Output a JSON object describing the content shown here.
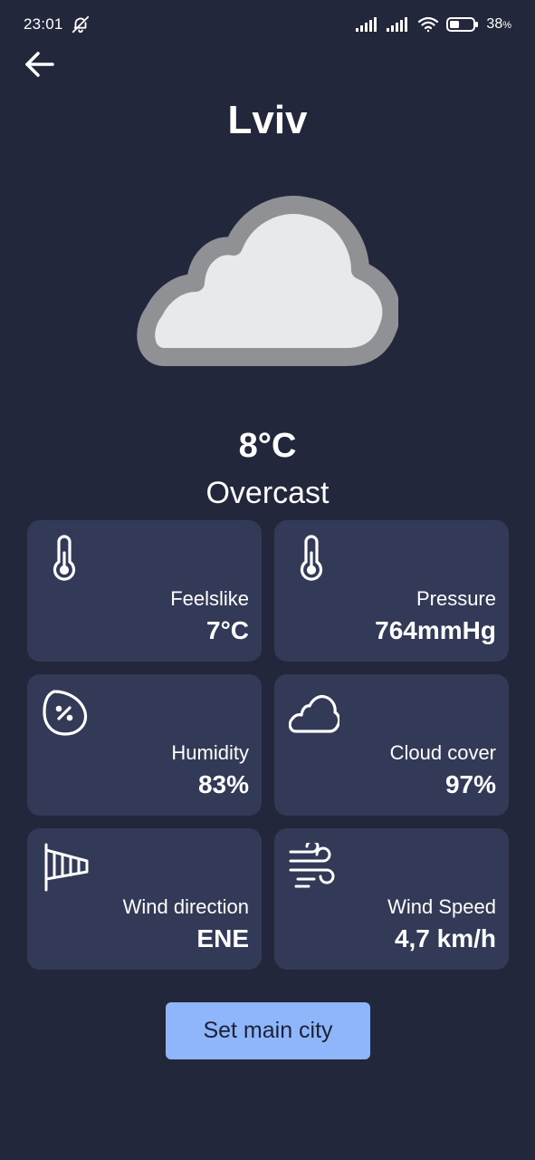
{
  "status_bar": {
    "time": "23:01",
    "battery_percent": "38",
    "battery_symbol": "%",
    "icons": [
      "bell-muted-icon",
      "cellular-signal-icon",
      "cellular-signal-icon",
      "wifi-icon",
      "battery-icon"
    ]
  },
  "header": {
    "back_icon": "arrow-left-icon",
    "city": "Lviv"
  },
  "current": {
    "icon": "cloud-icon",
    "temperature": "8°C",
    "condition": "Overcast"
  },
  "details": [
    {
      "icon": "thermometer-icon",
      "label": "Feelslike",
      "value": "7°C"
    },
    {
      "icon": "thermometer-icon",
      "label": "Pressure",
      "value": "764mmHg"
    },
    {
      "icon": "humidity-drop-icon",
      "label": "Humidity",
      "value": "83%"
    },
    {
      "icon": "cloud-outline-icon",
      "label": "Cloud cover",
      "value": "97%"
    },
    {
      "icon": "windsock-icon",
      "label": "Wind direction",
      "value": "ENE"
    },
    {
      "icon": "wind-icon",
      "label": "Wind Speed",
      "value": "4,7 km/h"
    }
  ],
  "actions": {
    "set_main_city": "Set main city"
  },
  "colors": {
    "background": "#23273b",
    "card": "#323a57",
    "button": "#8fb6fb",
    "button_text": "#1c2236",
    "text": "#ffffff"
  }
}
